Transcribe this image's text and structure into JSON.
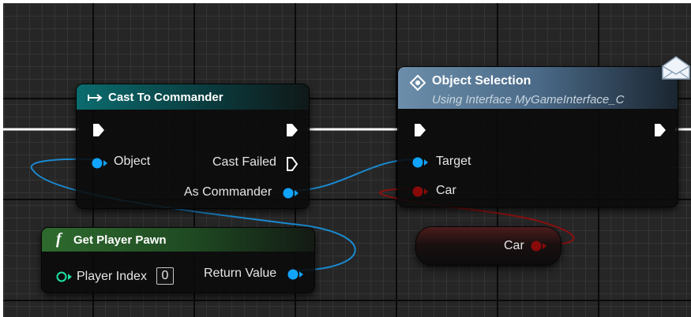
{
  "nodes": {
    "cast": {
      "title": "Cast To Commander",
      "pins": {
        "object": "Object",
        "cast_failed": "Cast Failed",
        "as_commander": "As Commander"
      }
    },
    "object_selection": {
      "title": "Object Selection",
      "subtitle": "Using Interface MyGameInterface_C",
      "pins": {
        "target": "Target",
        "car": "Car"
      }
    },
    "get_player_pawn": {
      "title": "Get Player Pawn",
      "pins": {
        "player_index": "Player Index",
        "player_index_value": "0",
        "return_value": "Return Value"
      }
    },
    "car_var": {
      "label": "Car"
    }
  },
  "colors": {
    "exec": "#ffffff",
    "object_pin": "#10a4ff",
    "struct_pin": "#8a0a0a",
    "int_pin": "#1fe0a4",
    "cast_header": "#0b6c6e",
    "interface_header": "#6c8eaa",
    "function_header": "#2e6b2e"
  },
  "icons": [
    "cast-arrow-icon",
    "interface-diamond-icon",
    "function-f-icon",
    "envelope-message-icon"
  ]
}
